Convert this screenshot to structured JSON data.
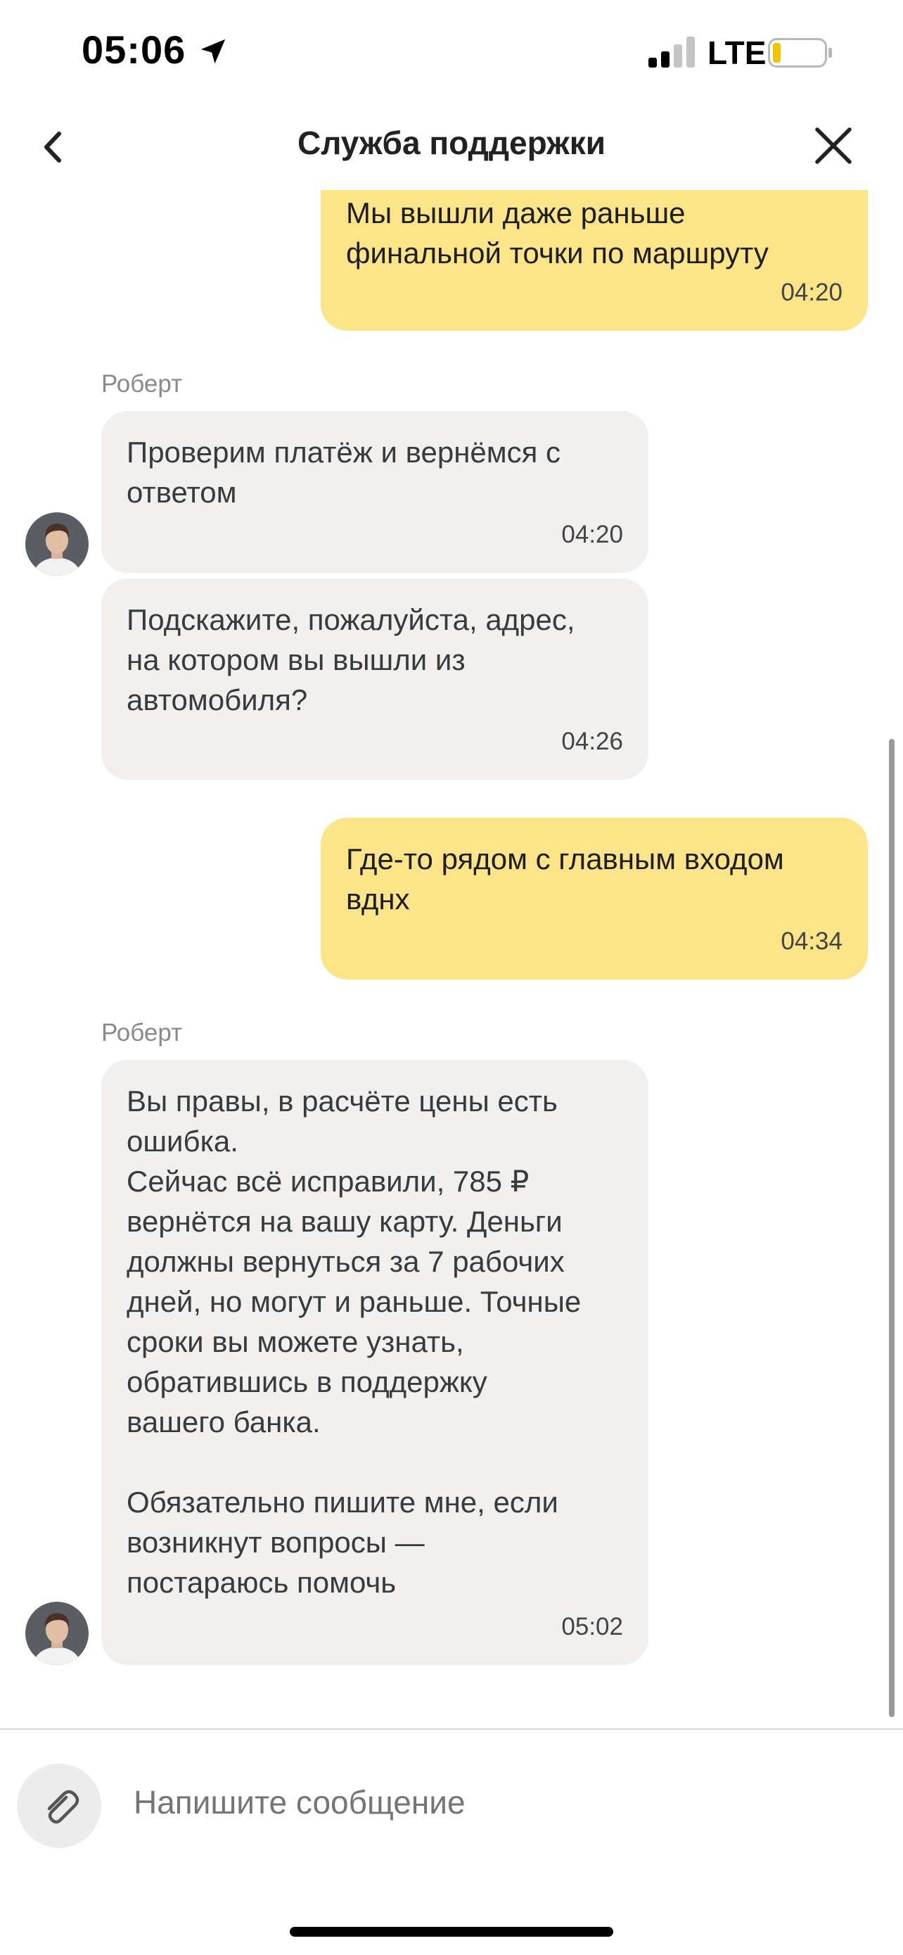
{
  "status_bar": {
    "time": "05:06",
    "network": "LTE",
    "battery_level": 0.15,
    "signal_bars_filled": 2,
    "signal_bars_total": 4
  },
  "header": {
    "title": "Служба поддержки",
    "back_icon": "chevron-left-icon",
    "close_icon": "close-icon"
  },
  "messages": [
    {
      "type": "out",
      "text": "Мы вышли даже раньше\nфинальной точки по маршруту",
      "time": "04:20"
    },
    {
      "type": "in",
      "sender": "Роберт",
      "text": "Проверим платёж и вернёмся с\nответом",
      "time": "04:20"
    },
    {
      "type": "in",
      "text": "Подскажите, пожалуйста, адрес,\nна котором вы вышли из\nавтомобиля?",
      "time": "04:26"
    },
    {
      "type": "out",
      "text": "Где-то рядом с главным входом\nвднх",
      "time": "04:34"
    },
    {
      "type": "in",
      "sender": "Роберт",
      "text": "Вы правы, в расчёте цены есть\nошибка.\nСейчас всё исправили, 785 ₽\nвернётся на вашу карту. Деньги\nдолжны вернуться за 7 рабочих\nдней, но могут и раньше. Точные\nсроки вы можете узнать,\nобратившись в поддержку\nвашего банка.\n\nОбязательно пишите мне, если\nвозникнут вопросы —\nпостараюсь помочь",
      "time": "05:02"
    }
  ],
  "composer": {
    "placeholder": "Напишите сообщение"
  },
  "colors": {
    "outgoing_bubble": "#fce489",
    "incoming_bubble": "#f1f0ee",
    "battery_fill": "#f5c400"
  }
}
